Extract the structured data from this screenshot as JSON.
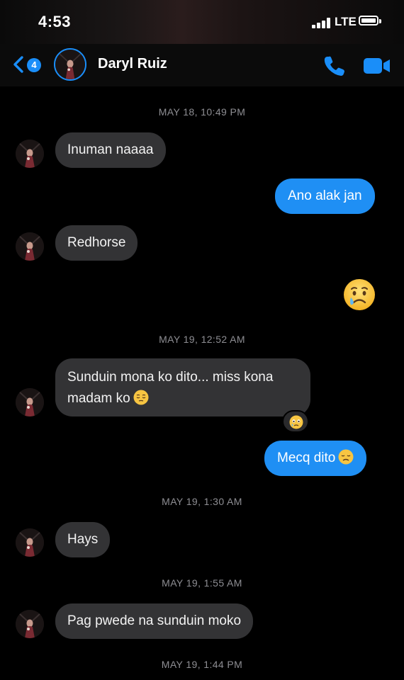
{
  "status_bar": {
    "time": "4:53",
    "network": "LTE",
    "icons": [
      "signal-bars-icon",
      "battery-icon"
    ]
  },
  "header": {
    "back_icon": "chevron-left-icon",
    "unread_badge": "4",
    "contact_name": "Daryl Ruiz",
    "actions": [
      "phone-icon",
      "video-camera-icon"
    ]
  },
  "conversation": {
    "timestamps": [
      "MAY 18, 10:49 PM",
      "MAY 19, 12:52 AM",
      "MAY 19, 1:30 AM",
      "MAY 19, 1:55 AM",
      "MAY 19, 1:44 PM"
    ],
    "messages": [
      {
        "direction": "incoming",
        "text": "Inuman naaaa"
      },
      {
        "direction": "outgoing",
        "text": "Ano alak jan"
      },
      {
        "direction": "incoming",
        "text": "Redhorse"
      },
      {
        "direction": "outgoing",
        "emoji": "crying-face"
      },
      {
        "direction": "incoming",
        "line1": "Sunduin mona ko dito... miss kona",
        "line2": "madam ko",
        "emoji": "pensive-face",
        "reaction": "sad-flushed-face"
      },
      {
        "direction": "outgoing",
        "text": "Mecq dito",
        "emoji": "disappointed-face"
      },
      {
        "direction": "incoming",
        "text": "Hays"
      },
      {
        "direction": "incoming",
        "text": "Pag pwede na sunduin moko"
      }
    ]
  },
  "colors": {
    "background": "#000000",
    "incoming_bubble": "#333335",
    "outgoing_bubble": "#1f8ff4",
    "accent": "#1a8ef9",
    "timestamp": "#8e8e93"
  }
}
